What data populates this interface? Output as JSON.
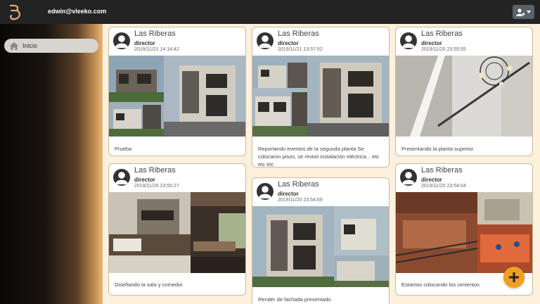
{
  "header": {
    "logo_icon": "b-logo-icon",
    "user_email": "edwin@vleeko.com",
    "user_menu_icon": "user-gear-icon"
  },
  "sidebar": {
    "items": [
      {
        "label": "Inicio",
        "icon": "home-icon"
      }
    ]
  },
  "posts": [
    {
      "project": "Las Riberas",
      "role": "director",
      "date": "2019/11/21 14:14:42",
      "caption": "Prueba",
      "image": "house-collage-photo"
    },
    {
      "project": "Las Riberas",
      "role": "director",
      "date": "2019/11/21 13:57:52",
      "caption": "Reportando eventos de la segunda planta Se colocaron pisos, se revisó instalación eléctrica... etc etc etc",
      "image": "house-exterior-collage-photo"
    },
    {
      "project": "Las Riberas",
      "role": "director",
      "date": "2019/11/20 23:55:55",
      "caption": "Presentando la planta superior",
      "image": "chandelier-photo"
    },
    {
      "project": "Las Riberas",
      "role": "director",
      "date": "2019/11/20 23:55:27",
      "caption": "Diseñando la sala y comedor",
      "image": "living-dining-photo"
    },
    {
      "project": "Las Riberas",
      "role": "director",
      "date": "2019/11/20 23:54:59",
      "caption": "Render de fachada presentado",
      "image": "facade-render-photo"
    },
    {
      "project": "Las Riberas",
      "role": "director",
      "date": "2019/11/20 23:54:04",
      "caption": "Estamos colocando los cimientos",
      "image": "foundation-photo"
    }
  ],
  "fab": {
    "icon": "plus-icon"
  },
  "colors": {
    "accent": "#f0a020",
    "topbar": "#232323",
    "background": "#fdf1dd"
  }
}
